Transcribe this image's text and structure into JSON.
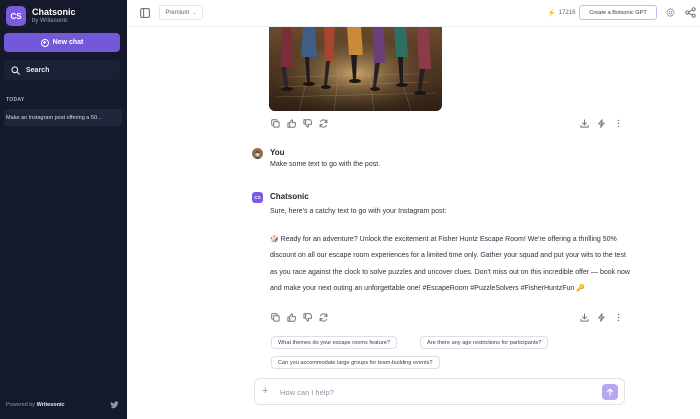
{
  "brand": {
    "logo_text": "CS",
    "name": "Chatsonic",
    "sub": "by Writesonic"
  },
  "sidebar": {
    "new_chat_label": "New chat",
    "search_label": "Search",
    "section_today": "TODAY",
    "history": [
      {
        "label": "Make an Instagram post offering a 50..."
      }
    ],
    "powered_by": "Powered by",
    "powered_brand": "Writesonic"
  },
  "topbar": {
    "model": "Premium",
    "credits": "17216",
    "botsonic_button": "Create a Botsonic GPT"
  },
  "chat": {
    "user_name": "You",
    "user_message": "Make some text to go with the post.",
    "bot_name": "Chatsonic",
    "bot_avatar_text": "CS",
    "bot_intro": "Sure, here's a catchy text to go with your Instagram post:",
    "bot_body": "🎲 Ready for an adventure? Unlock the excitement at Fisher Huntz Escape Room! We're offering a thrilling 50% discount on all our escape room experiences for a limited time only. Gather your squad and put your wits to the test as you race against the clock to solve puzzles and uncover clues. Don't miss out on this incredible offer — book now and make your next outing an unforgettable one! #EscapeRoom #PuzzleSolvers #FisherHuntzFun 🔑"
  },
  "suggestions": [
    "What themes do your escape rooms feature?",
    "Are there any age restrictions for participants?",
    "Can you accommodate large groups for team-building events?"
  ],
  "composer": {
    "placeholder": "How can I help?"
  },
  "colors": {
    "accent": "#7558d9",
    "sidebar_bg": "#141a2b",
    "send_bg": "#b9a6f0"
  },
  "icons": [
    "sidebar-toggle-icon",
    "bolt-icon",
    "gear-icon",
    "share-icon",
    "copy-icon",
    "thumbs-up-icon",
    "thumbs-down-icon",
    "regenerate-icon",
    "download-icon",
    "flash-icon",
    "more-icon",
    "plus-icon",
    "send-icon",
    "twitter-icon",
    "search-icon"
  ]
}
